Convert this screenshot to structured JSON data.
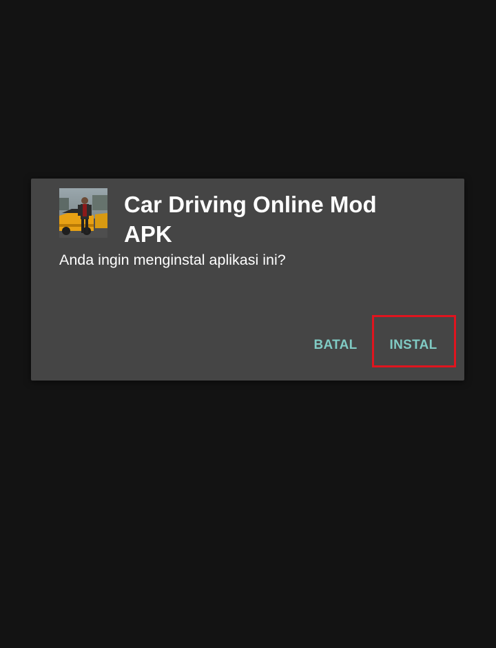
{
  "dialog": {
    "app_name": "Car Driving Online Mod APK",
    "app_icon": "car-driving-game-icon",
    "prompt": "Anda ingin menginstal aplikasi ini?",
    "buttons": {
      "cancel_label": "BATAL",
      "install_label": "INSTAL"
    }
  },
  "annotation": {
    "highlight_target": "install-button",
    "highlight_color": "#e0141e"
  },
  "colors": {
    "background": "#131313",
    "dialog_background": "#454545",
    "button_accent": "#80cbc4",
    "text": "#ffffff"
  }
}
